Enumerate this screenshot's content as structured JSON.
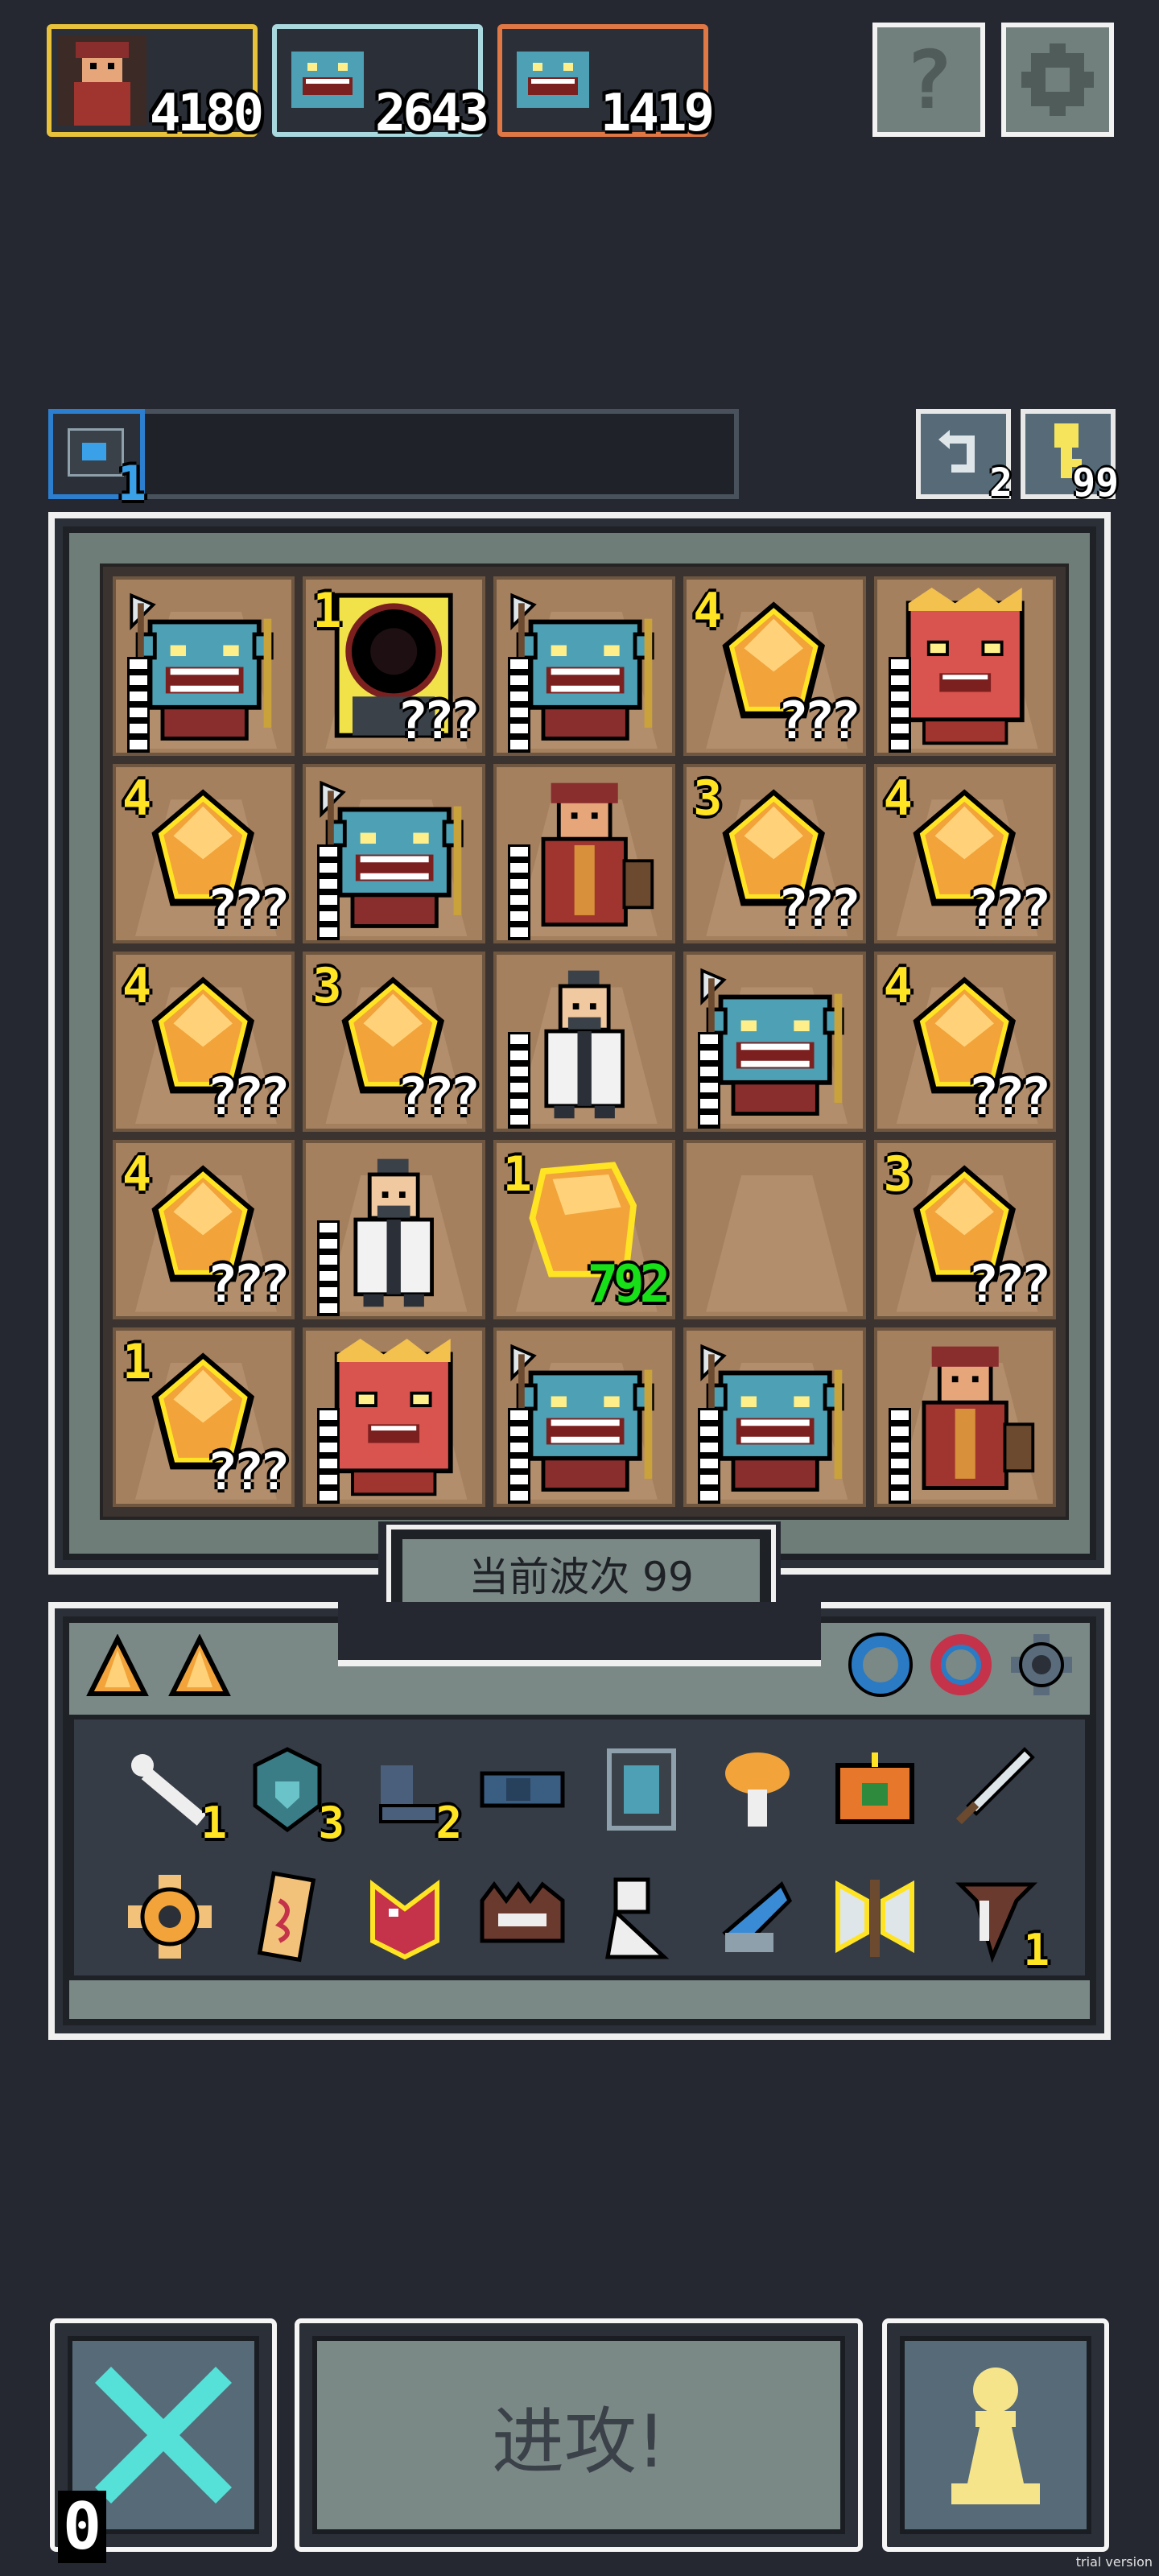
{
  "squads": [
    {
      "score": "4180",
      "border": "#e8c23a"
    },
    {
      "score": "2643",
      "border": "#a9d9de"
    },
    {
      "score": "1419",
      "border": "#e07845"
    }
  ],
  "top_buttons": [
    {
      "icon": "help-icon",
      "label": "?"
    },
    {
      "icon": "gear-icon"
    }
  ],
  "wave_bar": {
    "badge_count": "1",
    "progress": 0
  },
  "corner_counters": [
    {
      "icon": "undo-icon",
      "count": "2"
    },
    {
      "icon": "key-icon",
      "count": "99"
    }
  ],
  "board": {
    "cells": [
      {
        "type": "troll"
      },
      {
        "type": "portal",
        "level": "1",
        "tag": "???"
      },
      {
        "type": "troll"
      },
      {
        "type": "crystal",
        "level": "4",
        "tag": "???"
      },
      {
        "type": "lion"
      },
      {
        "type": "crystal",
        "level": "4",
        "tag": "???"
      },
      {
        "type": "troll"
      },
      {
        "type": "warrior"
      },
      {
        "type": "crystal",
        "level": "3",
        "tag": "???"
      },
      {
        "type": "crystal",
        "level": "4",
        "tag": "???"
      },
      {
        "type": "crystal",
        "level": "4",
        "tag": "???"
      },
      {
        "type": "crystal",
        "level": "3",
        "tag": "???"
      },
      {
        "type": "monk"
      },
      {
        "type": "troll"
      },
      {
        "type": "crystal",
        "level": "4",
        "tag": "???"
      },
      {
        "type": "crystal",
        "level": "4",
        "tag": "???"
      },
      {
        "type": "monk"
      },
      {
        "type": "gold",
        "level": "1",
        "tag": "792"
      },
      {
        "type": "empty"
      },
      {
        "type": "crystal",
        "level": "3",
        "tag": "???"
      },
      {
        "type": "crystal",
        "level": "1",
        "tag": "???"
      },
      {
        "type": "lion"
      },
      {
        "type": "troll"
      },
      {
        "type": "troll"
      },
      {
        "type": "warrior"
      }
    ]
  },
  "wave_label": "当前波次 99",
  "inventory": {
    "tabs": [
      {
        "icon": "crystal-tab-icon"
      },
      {
        "icon": "crystal-tab-icon"
      }
    ],
    "right_icons": [
      "blue-ring-icon",
      "red-ring-icon",
      "gear-ring-icon"
    ],
    "row1": [
      {
        "icon": "bone-icon",
        "count": "1"
      },
      {
        "icon": "heart-stone-icon",
        "count": "3"
      },
      {
        "icon": "boot-icon",
        "count": "2"
      },
      {
        "icon": "pipe-icon",
        "count": ""
      },
      {
        "icon": "mirror-icon",
        "count": ""
      },
      {
        "icon": "mushroom-icon",
        "count": ""
      },
      {
        "icon": "frame-icon",
        "count": ""
      },
      {
        "icon": "sword-icon",
        "count": ""
      }
    ],
    "row2": [
      {
        "icon": "sun-gear-icon",
        "count": ""
      },
      {
        "icon": "scroll-icon",
        "count": ""
      },
      {
        "icon": "beast-head-icon",
        "count": ""
      },
      {
        "icon": "spike-icon",
        "count": ""
      },
      {
        "icon": "statue-icon",
        "count": ""
      },
      {
        "icon": "horn-icon",
        "count": ""
      },
      {
        "icon": "axe-icon",
        "count": ""
      },
      {
        "icon": "tooth-icon",
        "count": "1"
      }
    ]
  },
  "bottom": {
    "cancel_count": "0",
    "attack_label": "进攻!",
    "corner_text": "trial version"
  }
}
